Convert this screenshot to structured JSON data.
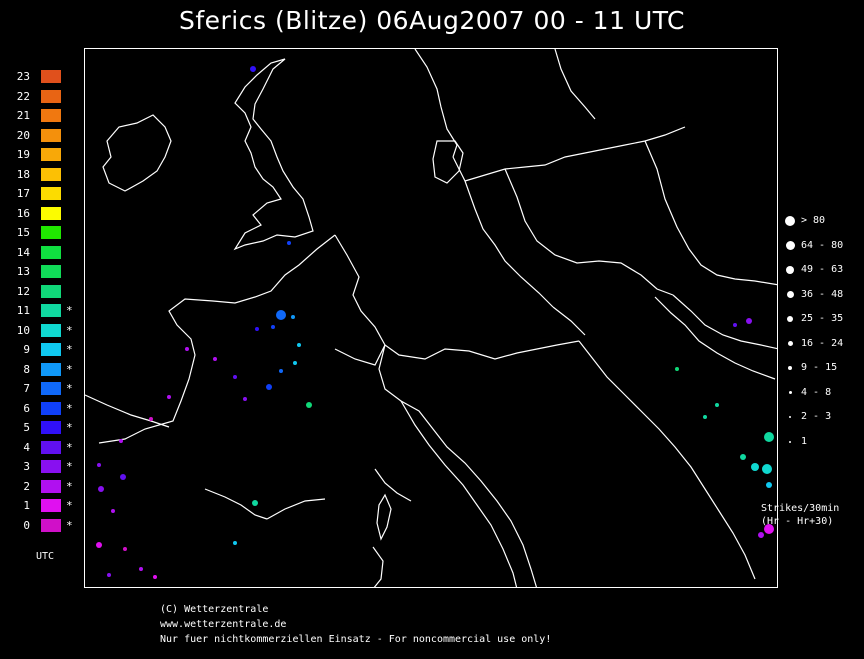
{
  "title": "Sferics (Blitze) 06Aug2007 00 - 11 UTC",
  "legend": {
    "axis_label": "UTC",
    "hours": [
      {
        "hour": "23",
        "color": "#e0501c",
        "marked": ""
      },
      {
        "hour": "22",
        "color": "#e86414",
        "marked": ""
      },
      {
        "hour": "21",
        "color": "#f07810",
        "marked": ""
      },
      {
        "hour": "20",
        "color": "#f4900c",
        "marked": ""
      },
      {
        "hour": "19",
        "color": "#f8a808",
        "marked": ""
      },
      {
        "hour": "18",
        "color": "#fcc004",
        "marked": ""
      },
      {
        "hour": "17",
        "color": "#fcdc00",
        "marked": ""
      },
      {
        "hour": "16",
        "color": "#fcfc00",
        "marked": ""
      },
      {
        "hour": "15",
        "color": "#20e800",
        "marked": ""
      },
      {
        "hour": "14",
        "color": "#10e040",
        "marked": ""
      },
      {
        "hour": "13",
        "color": "#10dc58",
        "marked": ""
      },
      {
        "hour": "12",
        "color": "#10d878",
        "marked": ""
      },
      {
        "hour": "11",
        "color": "#10d8a0",
        "marked": "*"
      },
      {
        "hour": "10",
        "color": "#10d8d0",
        "marked": "*"
      },
      {
        "hour": "9",
        "color": "#10c8f0",
        "marked": "*"
      },
      {
        "hour": "8",
        "color": "#1098f8",
        "marked": "*"
      },
      {
        "hour": "7",
        "color": "#1068f8",
        "marked": "*"
      },
      {
        "hour": "6",
        "color": "#1040f8",
        "marked": "*"
      },
      {
        "hour": "5",
        "color": "#3010f8",
        "marked": "*"
      },
      {
        "hour": "4",
        "color": "#6010f0",
        "marked": "*"
      },
      {
        "hour": "3",
        "color": "#8810f0",
        "marked": "*"
      },
      {
        "hour": "2",
        "color": "#b010f0",
        "marked": "*"
      },
      {
        "hour": "1",
        "color": "#e010f0",
        "marked": "*"
      },
      {
        "hour": "0",
        "color": "#d010c8",
        "marked": "*"
      }
    ]
  },
  "strike_sizes": [
    {
      "range": "> 80",
      "dot": 10
    },
    {
      "range": "64 - 80",
      "dot": 9
    },
    {
      "range": "49 - 63",
      "dot": 8
    },
    {
      "range": "36 - 48",
      "dot": 7
    },
    {
      "range": "25 - 35",
      "dot": 6
    },
    {
      "range": "16 - 24",
      "dot": 5
    },
    {
      "range": "9 - 15",
      "dot": 4
    },
    {
      "range": "4 - 8",
      "dot": 3
    },
    {
      "range": "2 - 3",
      "dot": 2
    },
    {
      "range": "1",
      "dot": 2
    }
  ],
  "strikes_note": "Strikes/30min\n(Hr - Hr+30)",
  "footer": {
    "copyright": "(C) Wetterzentrale",
    "url": "www.wetterzentrale.de",
    "notice": "Nur fuer nichtkommerziellen Einsatz - For noncommercial use only!"
  }
}
